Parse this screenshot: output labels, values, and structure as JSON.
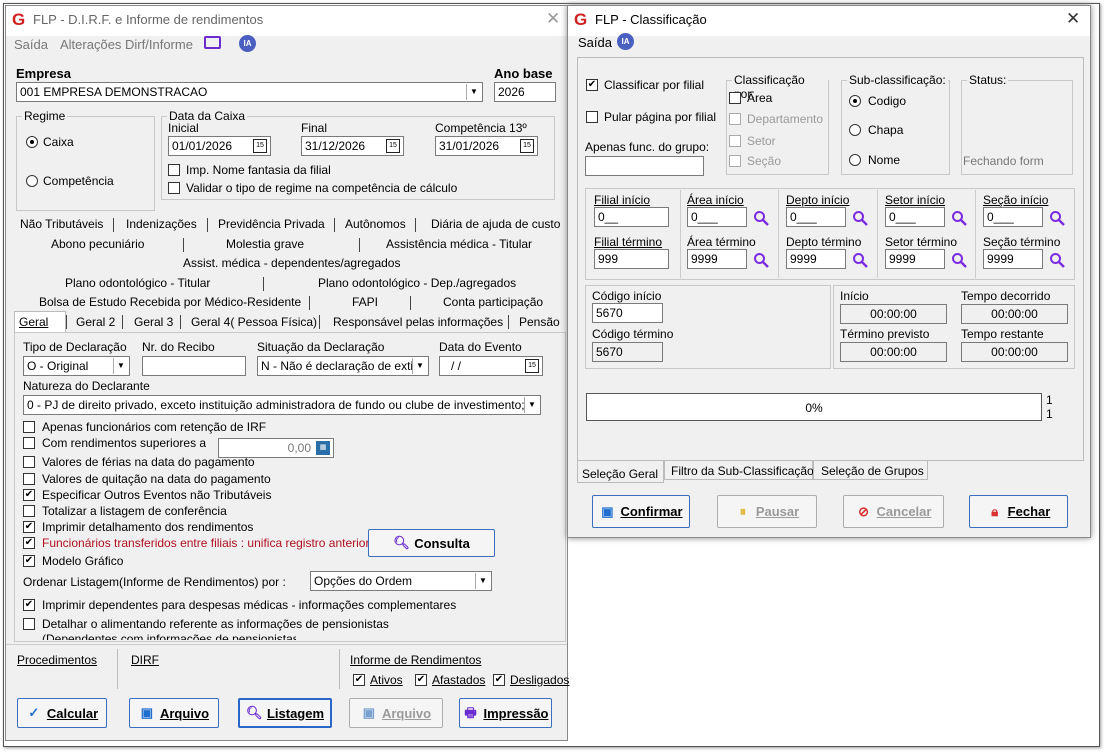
{
  "left": {
    "title": "FLP - D.I.R.F. e Informe de rendimentos",
    "menu": [
      "Saída",
      "Alterações Dirf/Informe"
    ],
    "ia": "IA",
    "empresa_label": "Empresa",
    "empresa_value": "001 EMPRESA DEMONSTRACAO",
    "ano_label": "Ano base",
    "ano_value": "2026",
    "regime_label": "Regime",
    "regime_caixa": "Caixa",
    "regime_comp": "Competência",
    "data_caixa_label": "Data da Caixa",
    "inicial_label": "Inicial",
    "inicial_value": "01/01/2026",
    "final_label": "Final",
    "final_value": "31/12/2026",
    "comp13_label": "Competência 13º",
    "comp13_value": "31/01/2026",
    "imp_nome": "Imp. Nome fantasia da filial",
    "validar": "Validar o tipo de regime na competência de cálculo",
    "tabs_row1": [
      "Não Tributáveis",
      "Indenizações",
      "Previdência Privada",
      "Autônomos",
      "Diária de ajuda de custo"
    ],
    "tabs_row2": [
      "Abono pecuniário",
      "Molestia grave",
      "Assistência médica - Titular"
    ],
    "tabs_row3": [
      "Assist. médica - dependentes/agregados"
    ],
    "tabs_row4": [
      "Plano odontológico - Titular",
      "Plano odontológico - Dep./agregados"
    ],
    "tabs_row5": [
      "Bolsa de Estudo Recebida por Médico-Residente",
      "FAPI",
      "Conta participação"
    ],
    "tabs_row6": [
      "Geral",
      "Geral 2",
      "Geral 3",
      "Geral 4( Pessoa Física)",
      "Responsável pelas informações",
      "Pensão"
    ],
    "tipo_decl_label": "Tipo de Declaração",
    "tipo_decl_value": "O - Original",
    "nr_recibo_label": "Nr. do Recibo",
    "nr_recibo_value": "",
    "situacao_label": "Situação da Declaração",
    "situacao_value": "N - Não é declaração de exti",
    "data_evento_label": "Data do Evento",
    "data_evento_value": "/ /",
    "natureza_label": "Natureza do Declarante",
    "natureza_value": "0 - PJ de direito privado, exceto instituição administradora de fundo ou clube de investimento;",
    "options": [
      {
        "label": "Apenas funcionários com retenção de IRF",
        "checked": false
      },
      {
        "label": "Com rendimentos superiores a",
        "checked": false
      },
      {
        "label": "Valores de férias na data do pagamento",
        "checked": false
      },
      {
        "label": "Valores de quitação na data do pagamento",
        "checked": false
      },
      {
        "label": "Especificar Outros Eventos não Tributáveis",
        "checked": true
      },
      {
        "label": "Totalizar a listagem de conferência",
        "checked": false
      },
      {
        "label": "Imprimir detalhamento dos rendimentos",
        "checked": true
      },
      {
        "label": "Funcionários transferidos entre filiais : unifica registro anterior",
        "checked": true
      },
      {
        "label": "Modelo Gráfico",
        "checked": true
      }
    ],
    "rendimentos_value": "0,00",
    "consulta": "Consulta",
    "ordenar_label": "Ordenar Listagem(Informe de Rendimentos) por :",
    "ordenar_value": "Opções do Ordem",
    "imprimir_dep": "Imprimir dependentes para despesas médicas - informações complementares",
    "detalhar": "Detalhar o alimentando referente as  informações de pensionistas",
    "detalhar_cont": "(Dependentes com informações de pensionistas)",
    "bottom_procedimentos": "Procedimentos",
    "bottom_dirf": "DIRF",
    "bottom_informe": "Informe de Rendimentos",
    "ativos": "Ativos",
    "afastados": "Afastados",
    "desligados": "Desligados",
    "btn_calcular": "Calcular",
    "btn_arquivo": "Arquivo",
    "btn_listagem": "Listagem",
    "btn_arquivo2": "Arquivo",
    "btn_impressao": "Impressão"
  },
  "right": {
    "title": "FLP - Classificação",
    "menu": "Saída",
    "ia": "IA",
    "classificar_filial": "Classificar por filial",
    "pular_pagina": "Pular página por filial",
    "apenas_func": "Apenas func. do grupo:",
    "class_por_label": "Classificação  por:",
    "class_por": [
      "Área",
      "Departamento",
      "Setor",
      "Seção"
    ],
    "sub_label": "Sub-classificação:",
    "sub": [
      "Codigo",
      "Chapa",
      "Nome"
    ],
    "status_label": "Status:",
    "status_value": "Fechando form",
    "filial_inicio": "Filial início",
    "filial_inicio_v": "0__",
    "filial_termino": "Filial término",
    "filial_termino_v": "999",
    "area_inicio": "Área início",
    "area_inicio_v": "0___",
    "area_termino": "Área término",
    "area_termino_v": "9999",
    "depto_inicio": "Depto início",
    "depto_inicio_v": "0___",
    "depto_termino": "Depto término",
    "depto_termino_v": "9999",
    "setor_inicio": "Setor início",
    "setor_inicio_v": "0___",
    "setor_termino": "Setor término",
    "setor_termino_v": "9999",
    "secao_inicio": "Seção início",
    "secao_inicio_v": "0___",
    "secao_termino": "Seção término",
    "secao_termino_v": "9999",
    "codigo_inicio": "Código início",
    "codigo_inicio_v": "5670",
    "codigo_termino": "Código término",
    "codigo_termino_v": "5670",
    "inicio": "Início",
    "inicio_v": "00:00:00",
    "tempo_decorrido": "Tempo decorrido",
    "tempo_decorrido_v": "00:00:00",
    "termino_previsto": "Término previsto",
    "termino_previsto_v": "00:00:00",
    "tempo_restante": "Tempo restante",
    "tempo_restante_v": "00:00:00",
    "progress_text": "0%",
    "progress": 0,
    "progress_count_a": "1",
    "progress_count_b": "1",
    "tabs": [
      "Seleção Geral",
      "Filtro da Sub-Classificação",
      "Seleção de Grupos"
    ],
    "btn_confirmar": "Confirmar",
    "btn_pausar": "Pausar",
    "btn_cancelar": "Cancelar",
    "btn_fechar": "Fechar"
  }
}
